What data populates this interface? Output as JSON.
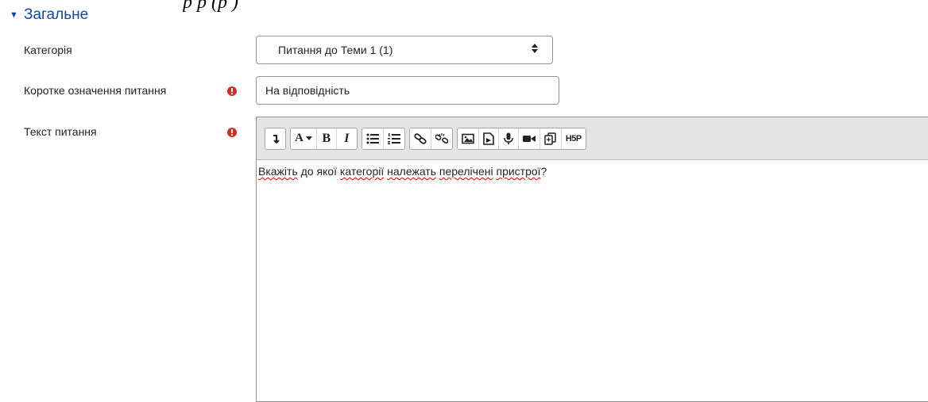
{
  "caption": "р                                                р        (р      )",
  "section": {
    "title": "Загальне"
  },
  "fields": {
    "category_label": "Категорія",
    "category_value": "Питання до Теми 1 (1)",
    "name_label": "Коротке означення питання",
    "name_value": "На відповідність",
    "text_label": "Текст питання"
  },
  "editor": {
    "content_words": [
      "Вкажіть",
      " до якої ",
      "категорії",
      " ",
      "належать",
      " ",
      "перелічені",
      " ",
      "пристрої",
      "?"
    ]
  },
  "toolbar_icons": [
    "collapse-icon",
    "font-color-icon",
    "bold-icon",
    "italic-icon",
    "unordered-list-icon",
    "ordered-list-icon",
    "link-icon",
    "unlink-icon",
    "image-icon",
    "media-icon",
    "record-audio-icon",
    "record-video-icon",
    "manage-files-icon",
    "h5p-icon"
  ],
  "colors": {
    "accent": "#0f47ad",
    "required": "#ca3120",
    "toolbar_bg": "#e4e4e4"
  }
}
